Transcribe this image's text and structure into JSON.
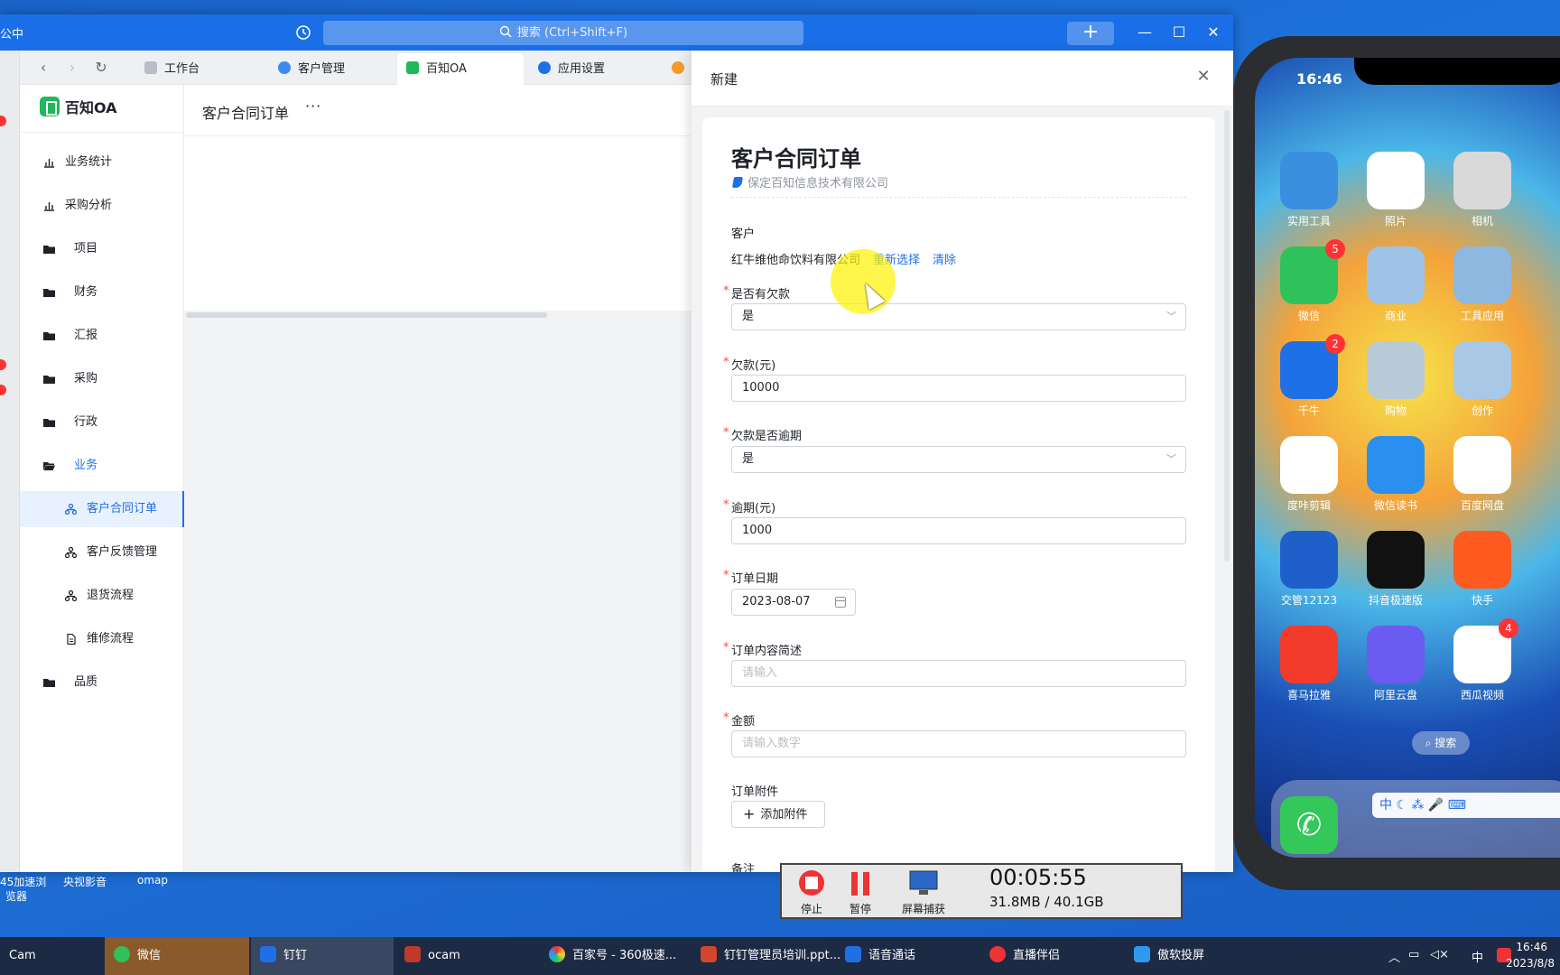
{
  "window": {
    "app_title": "公中",
    "search_placeholder": "搜索 (Ctrl+Shift+F)",
    "tabs": [
      {
        "label": "工作台"
      },
      {
        "label": "客户管理"
      },
      {
        "label": "百知OA"
      },
      {
        "label": "应用设置"
      }
    ]
  },
  "sidebar": {
    "brand": "百知OA",
    "items": [
      {
        "label": "业务统计"
      },
      {
        "label": "采购分析"
      },
      {
        "label": "项目"
      },
      {
        "label": "财务"
      },
      {
        "label": "汇报"
      },
      {
        "label": "采购"
      },
      {
        "label": "行政"
      },
      {
        "label": "业务"
      },
      {
        "label": "客户合同订单"
      },
      {
        "label": "客户反馈管理"
      },
      {
        "label": "退货流程"
      },
      {
        "label": "维修流程"
      },
      {
        "label": "品质"
      }
    ]
  },
  "content": {
    "title": "客户合同订单",
    "more": "···"
  },
  "drawer": {
    "title": "新建",
    "form_title": "客户合同订单",
    "org": "保定百知信息技术有限公司",
    "fields": {
      "customer_label": "客户",
      "customer_value": "红牛维他命饮料有限公司",
      "reselect": "重新选择",
      "clear": "清除",
      "debt_label": "是否有欠款",
      "debt_value": "是",
      "amount_owed_label": "欠款(元)",
      "amount_owed_value": "10000",
      "overdue_label": "欠款是否逾期",
      "overdue_value": "是",
      "overdue_amount_label": "逾期(元)",
      "overdue_amount_value": "1000",
      "order_date_label": "订单日期",
      "order_date_value": "2023-08-07",
      "summary_label": "订单内容简述",
      "summary_placeholder": "请输入",
      "money_label": "金额",
      "money_placeholder": "请输入数字",
      "attachment_label": "订单附件",
      "attachment_button": "添加附件",
      "remark_label": "备注"
    }
  },
  "desktop": {
    "icon_labels": [
      "45加速浏",
      "览器",
      "央视影音",
      "omap"
    ]
  },
  "recorder": {
    "stop": "停止",
    "pause": "暂停",
    "capture": "屏幕捕获",
    "time": "00:05:55",
    "size": "31.8MB / 40.1GB"
  },
  "taskbar": {
    "items": [
      {
        "label": "Cam"
      },
      {
        "label": "微信"
      },
      {
        "label": "钉钉"
      },
      {
        "label": "ocam"
      },
      {
        "label": "百家号 - 360极速..."
      },
      {
        "label": "钉钉管理员培训.ppt..."
      },
      {
        "label": "语音通话"
      },
      {
        "label": "直播伴侣"
      },
      {
        "label": "傲软投屏"
      }
    ],
    "ime": "中",
    "time": "16:46",
    "date": "2023/8/8"
  },
  "phone": {
    "time": "16:46",
    "apps": [
      {
        "label": "实用工具",
        "color": "#3a8fe0"
      },
      {
        "label": "照片",
        "color": "#ffffff"
      },
      {
        "label": "相机",
        "color": "#d9d9d9"
      },
      {
        "label": "微信",
        "color": "#2fc25b",
        "badge": "5"
      },
      {
        "label": "商业",
        "color": "#9fc3e6"
      },
      {
        "label": "工具应用",
        "color": "#8fb8e0"
      },
      {
        "label": "千牛",
        "color": "#1f6fe6",
        "badge": "2"
      },
      {
        "label": "购物",
        "color": "#b8c9d8"
      },
      {
        "label": "创作",
        "color": "#a9c8e6"
      },
      {
        "label": "度咔剪辑",
        "color": "#ffffff"
      },
      {
        "label": "微信读书",
        "color": "#2b8ff0"
      },
      {
        "label": "百度网盘",
        "color": "#ffffff"
      },
      {
        "label": "交管12123",
        "color": "#1e5fc9"
      },
      {
        "label": "抖音极速版",
        "color": "#111111"
      },
      {
        "label": "快手",
        "color": "#ff5a1f"
      },
      {
        "label": "喜马拉雅",
        "color": "#f23b2b"
      },
      {
        "label": "阿里云盘",
        "color": "#6a5cf0"
      },
      {
        "label": "西瓜视频",
        "color": "#ffffff",
        "badge": "4"
      }
    ],
    "search": "搜索",
    "ime_char": "中"
  }
}
